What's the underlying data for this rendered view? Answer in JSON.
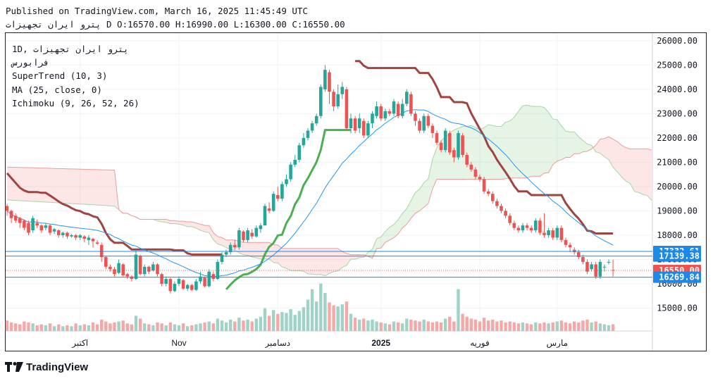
{
  "header": {
    "published": "Published on TradingView.com, March 16, 2025 11:45:49 UTC",
    "symbol": "پترو ایران تجهیزات",
    "ohlc": "D O:16570.00 H:16990.00 L:16300.00 C:16550.00"
  },
  "legend": {
    "interval": "1D",
    "symbol": "پترو ایران تجهیزات",
    "exchange": "فرابورس",
    "supertrend": "SuperTrend (10, 3)",
    "ma": "MA (25, close, 0)",
    "ichimoku": "Ichimoku (9, 26, 52, 26)"
  },
  "brand": {
    "name": "TradingView"
  },
  "chart_data": {
    "type": "candlestick",
    "interval": "1D",
    "y_range": [
      14100,
      26300
    ],
    "y_ticks": [
      15000,
      16000,
      17000,
      18000,
      19000,
      20000,
      21000,
      22000,
      23000,
      24000,
      25000,
      26000
    ],
    "y_tick_labels": [
      "15000.00",
      "16000.00",
      "17000.00",
      "18000.00",
      "19000.00",
      "20000.00",
      "21000.00",
      "22000.00",
      "23000.00",
      "24000.00",
      "25000.00",
      "26000.00"
    ],
    "x_labels": [
      {
        "label": "اکتبر",
        "bar": 17
      },
      {
        "label": "Nov",
        "bar": 40
      },
      {
        "label": "دسامبر",
        "bar": 63
      },
      {
        "label": "2025",
        "bar": 87
      },
      {
        "label": "فوریه",
        "bar": 110
      },
      {
        "label": "مارس",
        "bar": 128
      }
    ],
    "price_lines": [
      {
        "value": 17332.61,
        "label": "17332.61",
        "color": "#1e88e5"
      },
      {
        "value": 17139.38,
        "label": "17139.38",
        "color": "#1e88e5"
      },
      {
        "value": 16550.0,
        "label": "16550.00",
        "color": "#ef5350",
        "dotted": true
      },
      {
        "value": 16269.84,
        "label": "16269.84",
        "color": "#1e88e5"
      }
    ],
    "candles": [
      [
        19200,
        19000,
        19300,
        18800,
        1.1
      ],
      [
        19000,
        18700,
        19050,
        18500,
        0.9
      ],
      [
        18800,
        18600,
        18900,
        18500,
        0.8
      ],
      [
        18700,
        18500,
        18750,
        18300,
        0.7
      ],
      [
        18600,
        18300,
        18650,
        18200,
        1.0
      ],
      [
        18500,
        18100,
        18600,
        18000,
        0.9
      ],
      [
        18200,
        18700,
        18800,
        18100,
        0.8
      ],
      [
        18500,
        18400,
        18650,
        18300,
        0.6
      ],
      [
        18400,
        18200,
        18450,
        18100,
        0.7
      ],
      [
        18300,
        18400,
        18500,
        18200,
        0.6
      ],
      [
        18400,
        18100,
        18450,
        18000,
        0.8
      ],
      [
        18150,
        18250,
        18300,
        18050,
        0.5
      ],
      [
        18200,
        18000,
        18250,
        17900,
        0.7
      ],
      [
        18000,
        18100,
        18150,
        17900,
        0.5
      ],
      [
        18100,
        17950,
        18150,
        17850,
        0.6
      ],
      [
        17950,
        18000,
        18050,
        17900,
        0.5
      ],
      [
        18000,
        17900,
        18050,
        17800,
        0.8
      ],
      [
        17900,
        18000,
        18050,
        17800,
        0.6
      ],
      [
        17950,
        17850,
        18000,
        17700,
        0.7
      ],
      [
        17800,
        17900,
        18000,
        17600,
        0.6
      ],
      [
        17850,
        17750,
        17900,
        17500,
        0.9
      ],
      [
        17700,
        17650,
        17800,
        17600,
        0.7
      ],
      [
        17600,
        17100,
        17700,
        16900,
        1.2
      ],
      [
        17100,
        16700,
        17150,
        16600,
        1.0
      ],
      [
        16700,
        16600,
        16800,
        16500,
        0.8
      ],
      [
        16600,
        16400,
        16700,
        16300,
        0.9
      ],
      [
        16450,
        16850,
        17000,
        16400,
        1.0
      ],
      [
        16800,
        16350,
        16850,
        16300,
        1.1
      ],
      [
        16400,
        16300,
        16450,
        16200,
        0.8
      ],
      [
        16300,
        16200,
        16350,
        16100,
        0.7
      ],
      [
        16200,
        17200,
        17400,
        16150,
        1.6
      ],
      [
        17150,
        16400,
        17200,
        16350,
        1.3
      ],
      [
        16400,
        16700,
        16800,
        16300,
        0.8
      ],
      [
        16700,
        16500,
        16750,
        16400,
        0.7
      ],
      [
        16550,
        16800,
        16900,
        16500,
        0.6
      ],
      [
        16800,
        16400,
        16850,
        16300,
        0.9
      ],
      [
        16400,
        16000,
        16450,
        15900,
        0.8
      ],
      [
        16000,
        16200,
        16300,
        15900,
        0.6
      ],
      [
        16200,
        15700,
        16250,
        15600,
        0.9
      ],
      [
        15700,
        16000,
        16100,
        15650,
        0.7
      ],
      [
        16000,
        16200,
        16300,
        15900,
        0.6
      ],
      [
        16150,
        15800,
        16200,
        15750,
        0.8
      ],
      [
        15800,
        15950,
        16000,
        15700,
        0.5
      ],
      [
        15950,
        15750,
        16000,
        15700,
        0.6
      ],
      [
        15750,
        16100,
        16200,
        15700,
        0.7
      ],
      [
        16100,
        16300,
        16500,
        16000,
        0.8
      ],
      [
        16250,
        15900,
        16300,
        15850,
        0.9
      ],
      [
        15900,
        16500,
        16600,
        15850,
        1.0
      ],
      [
        16400,
        16200,
        16500,
        16100,
        0.8
      ],
      [
        16200,
        16900,
        17000,
        16150,
        1.3
      ],
      [
        16900,
        17200,
        17300,
        16800,
        1.1
      ],
      [
        17200,
        17300,
        17400,
        17100,
        0.9
      ],
      [
        17300,
        17600,
        17700,
        17200,
        1.2
      ],
      [
        17600,
        17500,
        17800,
        17400,
        1.0
      ],
      [
        17500,
        18200,
        18300,
        17400,
        1.4
      ],
      [
        18150,
        17800,
        18200,
        17700,
        1.1
      ],
      [
        17800,
        18200,
        18300,
        17700,
        1.2
      ],
      [
        18100,
        17950,
        18250,
        17850,
        1.0
      ],
      [
        17950,
        18300,
        18400,
        17900,
        1.3
      ],
      [
        18250,
        18400,
        18500,
        18100,
        1.5
      ],
      [
        18400,
        19200,
        19300,
        18400,
        2.4
      ],
      [
        19100,
        19000,
        19350,
        18900,
        1.6
      ],
      [
        19000,
        19700,
        19800,
        18950,
        2.2
      ],
      [
        19650,
        19500,
        20000,
        19400,
        1.8
      ],
      [
        19500,
        20100,
        20200,
        19400,
        2.0
      ],
      [
        20100,
        20300,
        20500,
        20000,
        1.9
      ],
      [
        20300,
        20900,
        21000,
        20200,
        2.3
      ],
      [
        20900,
        21100,
        21300,
        20800,
        1.7
      ],
      [
        21100,
        21700,
        21800,
        21000,
        2.1
      ],
      [
        21700,
        22000,
        22200,
        21600,
        2.5
      ],
      [
        22000,
        22300,
        22400,
        21900,
        3.3
      ],
      [
        22300,
        22600,
        22700,
        22200,
        4.4
      ],
      [
        22600,
        22900,
        23000,
        22500,
        3.1
      ],
      [
        22900,
        24100,
        24200,
        22800,
        5.0
      ],
      [
        24000,
        24800,
        25000,
        23900,
        4.0
      ],
      [
        24700,
        23900,
        24800,
        23400,
        3.0
      ],
      [
        23900,
        23300,
        24000,
        23100,
        2.7
      ],
      [
        23300,
        23800,
        24200,
        23200,
        2.6
      ],
      [
        23800,
        24100,
        24300,
        23600,
        2.8
      ],
      [
        24000,
        22400,
        24100,
        22300,
        3.1
      ],
      [
        22400,
        22800,
        23000,
        22200,
        1.8
      ],
      [
        22800,
        22300,
        22900,
        22200,
        1.4
      ],
      [
        22400,
        22800,
        23000,
        22200,
        1.2
      ],
      [
        22700,
        22100,
        22800,
        22000,
        1.3
      ],
      [
        22100,
        22600,
        22700,
        22000,
        1.1
      ],
      [
        22600,
        23000,
        23100,
        22400,
        1.2
      ],
      [
        22900,
        23300,
        23500,
        22800,
        1.0
      ],
      [
        23300,
        22800,
        23400,
        22700,
        0.9
      ],
      [
        22800,
        23100,
        23200,
        22700,
        0.8
      ],
      [
        23100,
        23000,
        23200,
        22900,
        0.7
      ],
      [
        23000,
        23500,
        23600,
        22900,
        1.0
      ],
      [
        23400,
        22900,
        23500,
        22800,
        0.9
      ],
      [
        22900,
        23400,
        23600,
        22800,
        0.8
      ],
      [
        23400,
        23900,
        24000,
        23300,
        1.3
      ],
      [
        23800,
        23000,
        23900,
        22900,
        1.2
      ],
      [
        23000,
        22700,
        23100,
        22500,
        1.1
      ],
      [
        22700,
        22300,
        22800,
        22200,
        1.0
      ],
      [
        22300,
        22900,
        23000,
        22200,
        1.2
      ],
      [
        22900,
        22500,
        23000,
        22400,
        1.0
      ],
      [
        22500,
        22200,
        22600,
        22000,
        0.9
      ],
      [
        22200,
        21800,
        22300,
        21700,
        1.0
      ],
      [
        21800,
        21500,
        21900,
        21400,
        0.9
      ],
      [
        21500,
        22300,
        22400,
        21400,
        1.3
      ],
      [
        22200,
        21400,
        22300,
        21300,
        1.5
      ],
      [
        21500,
        21200,
        21600,
        21000,
        1.0
      ],
      [
        21200,
        22200,
        22300,
        21100,
        4.4
      ],
      [
        22100,
        21300,
        22200,
        21200,
        1.8
      ],
      [
        21300,
        20900,
        21400,
        20800,
        1.5
      ],
      [
        20900,
        20700,
        21000,
        20600,
        1.3
      ],
      [
        20700,
        20400,
        20800,
        20300,
        1.2
      ],
      [
        20400,
        20300,
        20500,
        20200,
        1.0
      ],
      [
        20300,
        19800,
        20400,
        19700,
        1.4
      ],
      [
        19800,
        19700,
        19900,
        19600,
        1.1
      ],
      [
        19700,
        19400,
        19800,
        19300,
        1.2
      ],
      [
        19400,
        19200,
        19500,
        19100,
        1.0
      ],
      [
        19200,
        19000,
        19300,
        18900,
        1.1
      ],
      [
        19000,
        18800,
        19100,
        18700,
        0.9
      ],
      [
        18800,
        18500,
        18900,
        18400,
        1.0
      ],
      [
        18500,
        18300,
        18600,
        18200,
        0.9
      ],
      [
        18300,
        18200,
        18400,
        18100,
        0.8
      ],
      [
        18200,
        18400,
        18500,
        18100,
        0.9
      ],
      [
        18400,
        18300,
        18500,
        18200,
        0.8
      ],
      [
        18300,
        18200,
        18400,
        18100,
        0.7
      ],
      [
        18200,
        18600,
        18700,
        18100,
        0.9
      ],
      [
        18600,
        18100,
        18700,
        18000,
        0.8
      ],
      [
        18100,
        18000,
        18900,
        17900,
        0.9
      ],
      [
        18000,
        18200,
        18300,
        17900,
        0.8
      ],
      [
        18200,
        17900,
        18300,
        17800,
        0.9
      ],
      [
        17900,
        18300,
        18400,
        17800,
        1.0
      ],
      [
        18300,
        17800,
        18400,
        17700,
        1.1
      ],
      [
        17800,
        17600,
        17900,
        17500,
        0.9
      ],
      [
        17600,
        17500,
        17700,
        17300,
        0.8
      ],
      [
        17400,
        17300,
        17500,
        17200,
        1.0
      ],
      [
        17300,
        17100,
        17400,
        17000,
        0.9
      ],
      [
        17100,
        16900,
        17200,
        16800,
        1.1
      ],
      [
        16900,
        16500,
        17000,
        16400,
        1.2
      ],
      [
        16600,
        16800,
        16900,
        16500,
        0.9
      ],
      [
        16800,
        16300,
        16900,
        16200,
        1.0
      ],
      [
        16300,
        16900,
        17000,
        16200,
        0.8
      ],
      [
        16700,
        16700,
        16800,
        16500,
        0.7
      ],
      [
        16900,
        16900,
        17000,
        16800,
        0.6
      ],
      [
        16570,
        16550,
        16990,
        16300,
        0.7
      ]
    ]
  }
}
